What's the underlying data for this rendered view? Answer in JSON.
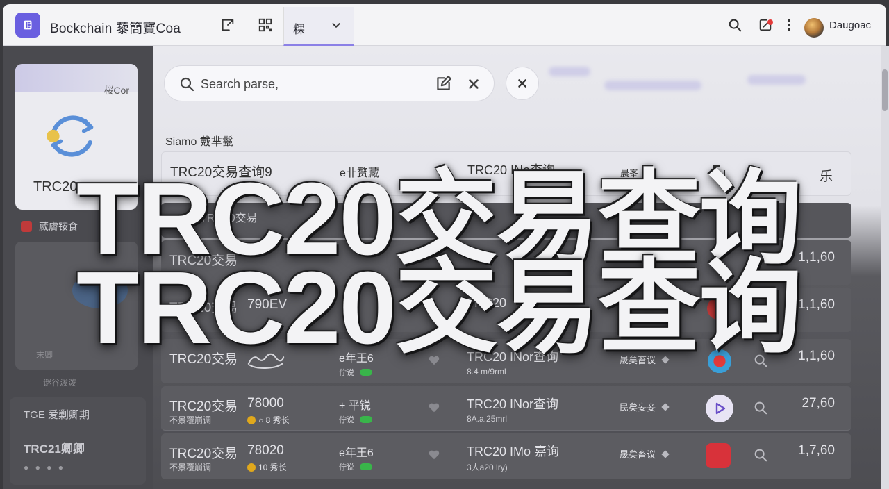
{
  "app": {
    "title": "Bockchain 藜簡寳Coa",
    "active_tab": "粿",
    "user_name": "Daugoac"
  },
  "sidebar": {
    "card_tag": "桜Cor",
    "card_title": "TRC20",
    "section_label": "葳膚铵食",
    "panel_footer": "末卿",
    "panel_caption": "谜谷泼泼",
    "bottom_title": "TGE 爱剿卿期",
    "bottom_sub": "TRC21卿卿",
    "bottom_dots": "● ● ● ●"
  },
  "search": {
    "placeholder": "Search parse,"
  },
  "section_title": "Siamo 戴芈鬣",
  "rows": [
    {
      "name": "TRC20交易查询9",
      "amount": "",
      "dir": "e卝赘藏",
      "type": "TRC20 INo查询",
      "label": "晨峯",
      "time": "乐"
    },
    {
      "name": "TRC20交易",
      "amount": "",
      "dir": "",
      "type": "",
      "label": "",
      "time": ""
    },
    {
      "name": "TRC20交易",
      "amount": "",
      "dir": "",
      "type": "",
      "label": "",
      "time": "1,1,60"
    },
    {
      "name": "TRC20交易",
      "amount": "790EV",
      "dir": "",
      "type": "TRC20",
      "label": "",
      "time": "1,1,60"
    },
    {
      "name": "TRC20交易",
      "amount": "",
      "sub": "",
      "fee": "",
      "dir": "e年王6",
      "status": "佇说",
      "type": "TRC20 INor查询",
      "hash": "8.4 m/9rml",
      "label": "晟矣畜议",
      "time": "1,1,60"
    },
    {
      "name": "TRC20交易",
      "amount": "78000",
      "sub": "不景覆崩调",
      "fee": "○ 8 秀长",
      "dir": "+ 平锐",
      "status": "佇说",
      "type": "TRC20 INor查询",
      "hash": "8A.a.25mrl",
      "label": "民矣妄妾",
      "time": "27,60"
    },
    {
      "name": "TRC20交易",
      "amount": "78020",
      "sub": "不景覆崩调",
      "fee": "10 秀长",
      "dir": "e年王6",
      "status": "佇说",
      "type": "TRC20 IMo 嘉询",
      "hash": "3人a20 lry)",
      "label": "晟矣畜议",
      "time": "1,7,60"
    }
  ],
  "overlay": {
    "line1": "TRC20交易查询",
    "line2": "TRC20交易查询"
  },
  "colors": {
    "accent": "#6a5fe0",
    "notification": "#e43a3a",
    "status_green": "#39b54a",
    "coin": "#e0a81c"
  }
}
